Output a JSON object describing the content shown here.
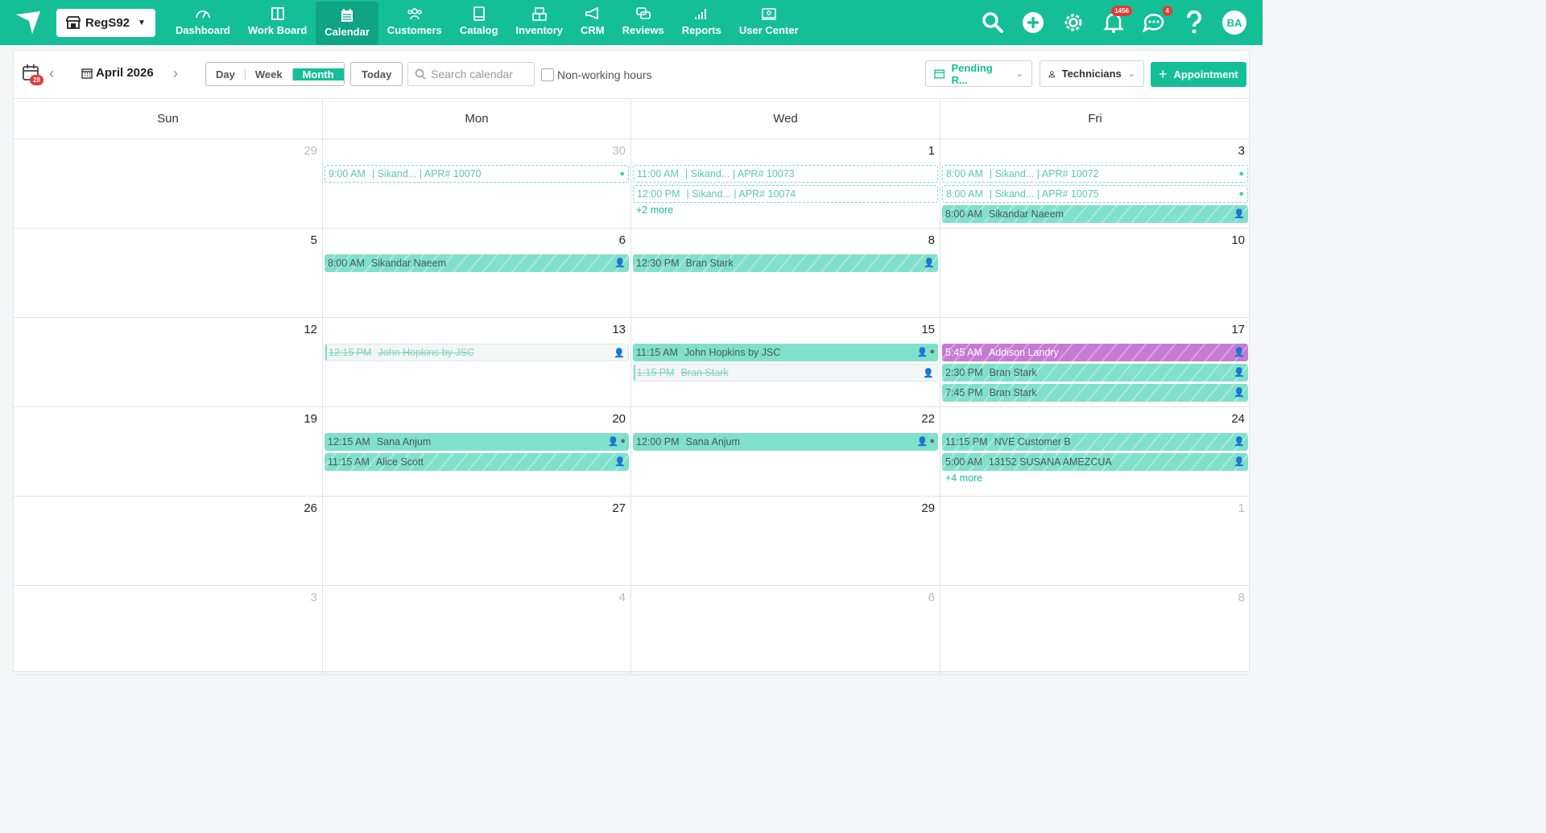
{
  "store": {
    "name": "RegS92"
  },
  "nav": [
    {
      "label": "Dashboard",
      "icon": "dashboard-icon",
      "active": false
    },
    {
      "label": "Work Board",
      "icon": "workboard-icon",
      "active": false
    },
    {
      "label": "Calendar",
      "icon": "calendar-icon",
      "active": true
    },
    {
      "label": "Customers",
      "icon": "customers-icon",
      "active": false
    },
    {
      "label": "Catalog",
      "icon": "catalog-icon",
      "active": false
    },
    {
      "label": "Inventory",
      "icon": "inventory-icon",
      "active": false
    },
    {
      "label": "CRM",
      "icon": "megaphone-icon",
      "active": false
    },
    {
      "label": "Reviews",
      "icon": "reviews-icon",
      "active": false
    },
    {
      "label": "Reports",
      "icon": "reports-icon",
      "active": false
    },
    {
      "label": "User Center",
      "icon": "user-center-icon",
      "active": false
    }
  ],
  "header": {
    "notifications_count": "1456",
    "messages_count": "4",
    "avatar_initials": "BA"
  },
  "toolbar": {
    "calendar_badge": "28",
    "month_label": "April 2026",
    "views": [
      "Day",
      "Week",
      "Month"
    ],
    "active_view": "Month",
    "today_label": "Today",
    "search_placeholder": "Search calendar",
    "nonworking_label": "Non-working hours",
    "pending_label": "Pending R...",
    "technicians_label": "Technicians",
    "appointment_label": "Appointment"
  },
  "colors": {
    "brand": "#14bf98",
    "event": "#7fe0cb",
    "purple_event": "#c57ad4",
    "badge": "#e53935"
  },
  "days_of_week": [
    "Sun",
    "Mon",
    "Wed",
    "Fri"
  ],
  "weeks": [
    {
      "cells": [
        {
          "day": "29",
          "other": true,
          "events": []
        },
        {
          "day": "30",
          "other": true,
          "events": [
            {
              "time": "9:00 AM",
              "text": "| Sikand... | APR# 10070",
              "style": "dashed",
              "icons": "check"
            }
          ]
        },
        {
          "day": "1",
          "other": false,
          "events": [
            {
              "time": "11:00 AM",
              "text": "| Sikand... | APR# 10073",
              "style": "dashed",
              "icons": ""
            },
            {
              "time": "12:00 PM",
              "text": "| Sikand... | APR# 10074",
              "style": "dashed",
              "icons": ""
            }
          ],
          "more": "+2 more"
        },
        {
          "day": "3",
          "other": false,
          "events": [
            {
              "time": "8:00 AM",
              "text": "| Sikand... | APR# 10072",
              "style": "dashed",
              "icons": "check"
            },
            {
              "time": "8:00 AM",
              "text": "| Sikand... | APR# 10075",
              "style": "dashed",
              "icons": "check"
            },
            {
              "time": "8:00 AM",
              "text": "Sikandar Naeem",
              "style": "striped",
              "icons": "person"
            }
          ]
        }
      ]
    },
    {
      "cells": [
        {
          "day": "5",
          "other": false,
          "events": []
        },
        {
          "day": "6",
          "other": false,
          "events": [
            {
              "time": "8:00 AM",
              "text": "Sikandar Naeem",
              "style": "striped",
              "icons": "person"
            }
          ]
        },
        {
          "day": "8",
          "other": false,
          "events": [
            {
              "time": "12:30 PM",
              "text": "Bran Stark",
              "style": "striped",
              "icons": "person"
            }
          ]
        },
        {
          "day": "10",
          "other": false,
          "events": []
        }
      ]
    },
    {
      "cells": [
        {
          "day": "12",
          "other": false,
          "events": []
        },
        {
          "day": "13",
          "other": false,
          "events": [
            {
              "time": "12:15 PM",
              "text": "John Hopkins by JSC",
              "style": "cancel",
              "icons": "person"
            }
          ]
        },
        {
          "day": "15",
          "other": false,
          "events": [
            {
              "time": "11:15 AM",
              "text": "John Hopkins by JSC",
              "style": "solid",
              "icons": "person-check"
            },
            {
              "time": "1:15 PM",
              "text": "Bran Stark",
              "style": "cancel",
              "icons": "person"
            }
          ]
        },
        {
          "day": "17",
          "other": false,
          "events": [
            {
              "time": "5:45 AM",
              "text": "Addison Landry",
              "style": "purple",
              "icons": "person"
            },
            {
              "time": "2:30 PM",
              "text": "Bran Stark",
              "style": "striped",
              "icons": "person"
            },
            {
              "time": "7:45 PM",
              "text": "Bran Stark",
              "style": "striped",
              "icons": "person"
            }
          ]
        }
      ]
    },
    {
      "cells": [
        {
          "day": "19",
          "other": false,
          "events": []
        },
        {
          "day": "20",
          "other": false,
          "events": [
            {
              "time": "12:15 AM",
              "text": "Sana Anjum",
              "style": "solid",
              "icons": "person-check"
            },
            {
              "time": "11:15 AM",
              "text": "Alice Scott",
              "style": "striped",
              "icons": "person"
            }
          ]
        },
        {
          "day": "22",
          "other": false,
          "events": [
            {
              "time": "12:00 PM",
              "text": "Sana Anjum",
              "style": "solid",
              "icons": "person-check"
            }
          ]
        },
        {
          "day": "24",
          "other": false,
          "events": [
            {
              "time": "11:15 PM",
              "text": "NVE Customer B",
              "style": "striped",
              "icons": "person"
            },
            {
              "time": "5:00 AM",
              "text": "13152 SUSANA AMEZCUA",
              "style": "striped",
              "icons": "person"
            }
          ],
          "more": "+4 more"
        }
      ]
    },
    {
      "cells": [
        {
          "day": "26",
          "other": false,
          "events": []
        },
        {
          "day": "27",
          "other": false,
          "events": []
        },
        {
          "day": "29",
          "other": false,
          "events": []
        },
        {
          "day": "1",
          "other": true,
          "events": []
        }
      ]
    },
    {
      "cells": [
        {
          "day": "3",
          "other": true,
          "events": []
        },
        {
          "day": "4",
          "other": true,
          "events": []
        },
        {
          "day": "6",
          "other": true,
          "events": []
        },
        {
          "day": "8",
          "other": true,
          "events": []
        }
      ]
    }
  ]
}
